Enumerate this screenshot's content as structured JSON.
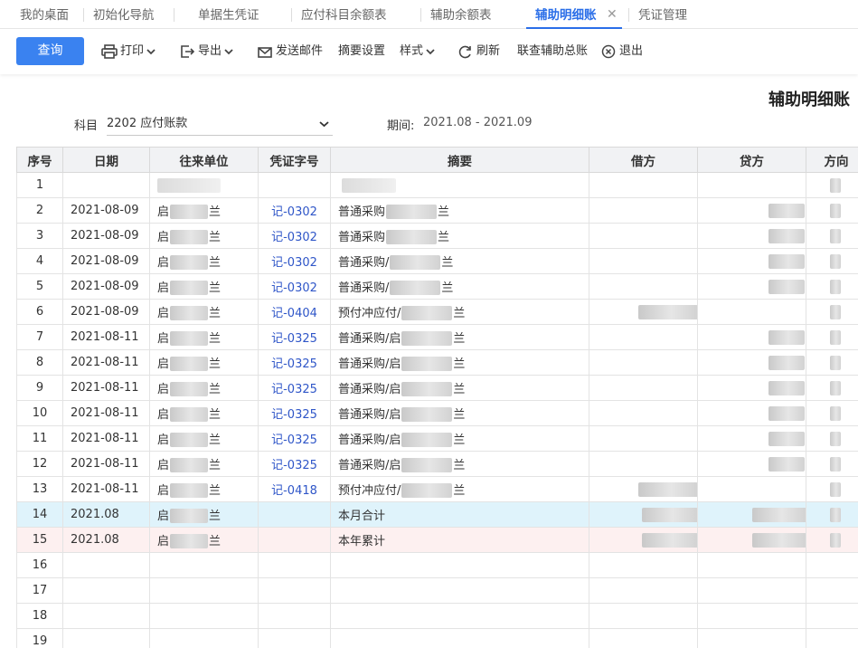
{
  "tabs": [
    {
      "label": "我的桌面",
      "active": false
    },
    {
      "label": "初始化导航",
      "active": false
    },
    {
      "label": "单据生凭证",
      "active": false
    },
    {
      "label": "应付科目余额表",
      "active": false
    },
    {
      "label": "辅助余额表",
      "active": false
    },
    {
      "label": "辅助明细账",
      "active": true
    },
    {
      "label": "凭证管理",
      "active": false
    }
  ],
  "tab_close": "✕",
  "toolbar": {
    "query": "查询",
    "print": "打印",
    "export": "导出",
    "email": "发送邮件",
    "summary_settings": "摘要设置",
    "style": "样式",
    "refresh": "刷新",
    "linked_ledger": "联查辅助总账",
    "exit": "退出"
  },
  "report_title": "辅助明细账",
  "filters": {
    "subject_label": "科目",
    "subject_value": "2202 应付账款",
    "period_label": "期间:",
    "period_value": "2021.08 - 2021.09"
  },
  "table": {
    "columns": [
      "序号",
      "日期",
      "往来单位",
      "凭证字号",
      "摘要",
      "借方",
      "贷方",
      "方向"
    ],
    "rows": [
      {
        "no": "1",
        "date": "",
        "unit": "",
        "voucher": "",
        "summary": ""
      },
      {
        "no": "2",
        "date": "2021-08-09",
        "unit": "启",
        "unit_tail": "兰",
        "voucher": "记-0302",
        "summary": "普通采购",
        "summary_tail": "兰"
      },
      {
        "no": "3",
        "date": "2021-08-09",
        "unit": "启",
        "unit_tail": "兰",
        "voucher": "记-0302",
        "summary": "普通采购",
        "summary_tail": "兰"
      },
      {
        "no": "4",
        "date": "2021-08-09",
        "unit": "启",
        "unit_tail": "兰",
        "voucher": "记-0302",
        "summary": "普通采购/",
        "summary_tail": "兰"
      },
      {
        "no": "5",
        "date": "2021-08-09",
        "unit": "启",
        "unit_tail": "兰",
        "voucher": "记-0302",
        "summary": "普通采购/",
        "summary_tail": "兰"
      },
      {
        "no": "6",
        "date": "2021-08-09",
        "unit": "启",
        "unit_tail": "兰",
        "voucher": "记-0404",
        "summary": "预付冲应付/",
        "summary_tail": "兰"
      },
      {
        "no": "7",
        "date": "2021-08-11",
        "unit": "启",
        "unit_tail": "兰",
        "voucher": "记-0325",
        "summary": "普通采购/启",
        "summary_tail": "兰"
      },
      {
        "no": "8",
        "date": "2021-08-11",
        "unit": "启",
        "unit_tail": "兰",
        "voucher": "记-0325",
        "summary": "普通采购/启",
        "summary_tail": "兰"
      },
      {
        "no": "9",
        "date": "2021-08-11",
        "unit": "启",
        "unit_tail": "兰",
        "voucher": "记-0325",
        "summary": "普通采购/启",
        "summary_tail": "兰"
      },
      {
        "no": "10",
        "date": "2021-08-11",
        "unit": "启",
        "unit_tail": "兰",
        "voucher": "记-0325",
        "summary": "普通采购/启",
        "summary_tail": "兰"
      },
      {
        "no": "11",
        "date": "2021-08-11",
        "unit": "启",
        "unit_tail": "兰",
        "voucher": "记-0325",
        "summary": "普通采购/启",
        "summary_tail": "兰"
      },
      {
        "no": "12",
        "date": "2021-08-11",
        "unit": "启",
        "unit_tail": "兰",
        "voucher": "记-0325",
        "summary": "普通采购/启",
        "summary_tail": "兰"
      },
      {
        "no": "13",
        "date": "2021-08-11",
        "unit": "启",
        "unit_tail": "兰",
        "voucher": "记-0418",
        "summary": "预付冲应付/",
        "summary_tail": "兰"
      },
      {
        "no": "14",
        "date": "2021.08",
        "unit": "启",
        "unit_tail": "兰",
        "voucher": "",
        "summary": "本月合计",
        "summary_tail": ""
      },
      {
        "no": "15",
        "date": "2021.08",
        "unit": "启",
        "unit_tail": "兰",
        "voucher": "",
        "summary": "本年累计",
        "summary_tail": ""
      },
      {
        "no": "16",
        "date": "",
        "unit": "",
        "voucher": "",
        "summary": ""
      },
      {
        "no": "17",
        "date": "",
        "unit": "",
        "voucher": "",
        "summary": ""
      },
      {
        "no": "18",
        "date": "",
        "unit": "",
        "voucher": "",
        "summary": ""
      },
      {
        "no": "19",
        "date": "",
        "unit": "",
        "voucher": "",
        "summary": ""
      }
    ]
  },
  "colors": {
    "accent": "#2a6ee8",
    "query_button": "#3a82f0",
    "voucher_link": "#2f56c8",
    "month_total_row": "#dff3fb",
    "year_total_row": "#fdf0f0"
  }
}
